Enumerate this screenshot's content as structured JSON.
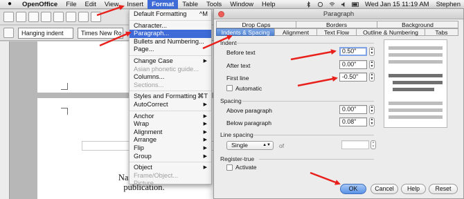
{
  "menubar": {
    "app": "OpenOffice",
    "items": [
      "File",
      "Edit",
      "View",
      "Insert",
      "Format",
      "Table",
      "Tools",
      "Window",
      "Help"
    ],
    "active": "Format",
    "clock": "Wed Jan 15  11:19 AM",
    "user": "Stephen"
  },
  "toolbar": {
    "style_value": "Hanging indent",
    "font_value": "Times New Ro"
  },
  "document": {
    "line1": "Name of autho",
    "line2": "publication."
  },
  "format_menu": {
    "items": [
      {
        "label": "Default Formatting",
        "shortcut": "^M"
      },
      {
        "label": "Character..."
      },
      {
        "label": "Paragraph...",
        "highlighted": true
      },
      {
        "label": "Bullets and Numbering..."
      },
      {
        "label": "Page..."
      },
      {
        "label": "Change Case",
        "submenu": true
      },
      {
        "label": "Asian phonetic guide...",
        "disabled": true
      },
      {
        "label": "Columns..."
      },
      {
        "label": "Sections...",
        "disabled": true
      },
      {
        "label": "Styles and Formatting",
        "shortcut": "⌘T"
      },
      {
        "label": "AutoCorrect",
        "submenu": true
      },
      {
        "label": "Anchor",
        "submenu": true
      },
      {
        "label": "Wrap",
        "submenu": true
      },
      {
        "label": "Alignment",
        "submenu": true
      },
      {
        "label": "Arrange",
        "submenu": true
      },
      {
        "label": "Flip",
        "submenu": true
      },
      {
        "label": "Group",
        "submenu": true
      },
      {
        "label": "Object",
        "submenu": true
      },
      {
        "label": "Frame/Object...",
        "disabled": true
      },
      {
        "label": "Picture...",
        "disabled": true
      }
    ]
  },
  "dialog": {
    "title": "Paragraph",
    "tabs_row1": [
      "Drop Caps",
      "Borders",
      "Background"
    ],
    "tabs_row2": [
      "Indents & Spacing",
      "Alignment",
      "Text Flow",
      "Outline & Numbering",
      "Tabs"
    ],
    "selected_tab": "Indents & Spacing",
    "indent": {
      "label": "Indent",
      "before_text_label": "Before text",
      "before_text_value": "0.50\"",
      "after_text_label": "After text",
      "after_text_value": "0.00\"",
      "first_line_label": "First line",
      "first_line_value": "-0.50\"",
      "automatic_label": "Automatic"
    },
    "spacing": {
      "label": "Spacing",
      "above_label": "Above paragraph",
      "above_value": "0.00\"",
      "below_label": "Below paragraph",
      "below_value": "0.08\""
    },
    "line_spacing": {
      "label": "Line spacing",
      "value": "Single",
      "of_label": "of",
      "of_value": ""
    },
    "register": {
      "label": "Register-true",
      "activate_label": "Activate"
    },
    "buttons": {
      "ok": "OK",
      "cancel": "Cancel",
      "help": "Help",
      "reset": "Reset"
    }
  },
  "colors": {
    "highlight": "#3e6bd7",
    "annotation_arrow": "#e8201c"
  }
}
